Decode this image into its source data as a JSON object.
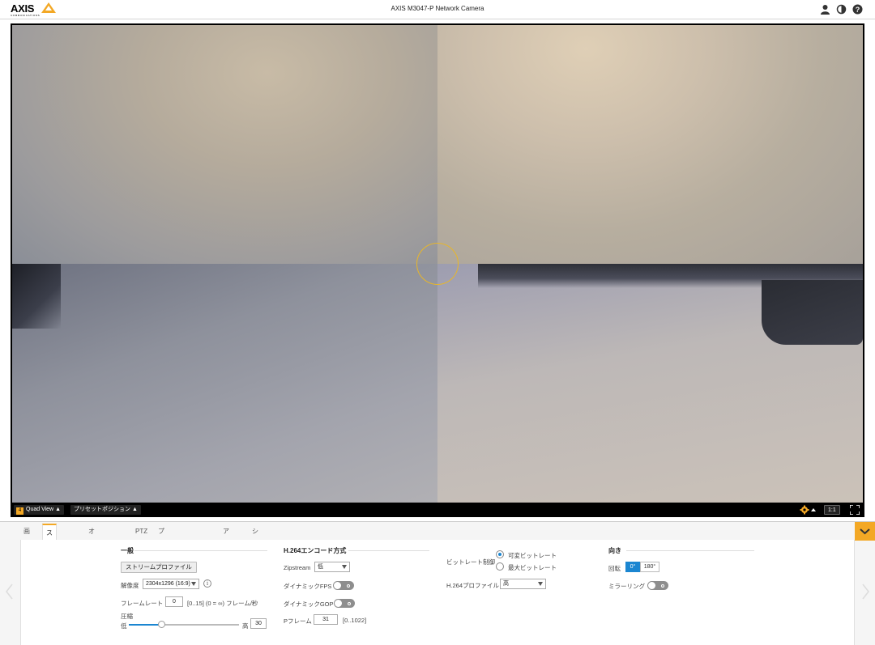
{
  "header": {
    "logo_word": "AXIS",
    "logo_sub": "COMMUNICATIONS",
    "title": "AXIS M3047-P Network Camera",
    "icons": [
      "user-icon",
      "contrast-icon",
      "help-icon"
    ]
  },
  "video_toolbar": {
    "quad_badge": "4",
    "quad_label": "Quad View",
    "preset_label": "プリセットポジション",
    "ratio_label": "1:1"
  },
  "tabs": [
    {
      "label": "画像",
      "active": false
    },
    {
      "label": "ストリーム",
      "active": true
    },
    {
      "label": "オーバーレイ",
      "active": false
    },
    {
      "label": "PTZ",
      "active": false
    },
    {
      "label": "プライバシーマスク",
      "active": false
    },
    {
      "label": "アプリ",
      "active": false
    },
    {
      "label": "システム",
      "active": false
    }
  ],
  "general": {
    "title": "一般",
    "stream_profile_button": "ストリームプロファイル",
    "resolution_label": "解像度",
    "resolution_value": "2304x1296 (16:9)",
    "framerate_label": "フレームレート",
    "framerate_value": "0",
    "framerate_hint": "[0..15] (0 = ∞) フレーム/秒",
    "compression_label": "圧縮",
    "compression_low": "低",
    "compression_high": "高",
    "compression_value": "30",
    "compression_fraction": 0.3
  },
  "h264": {
    "title": "H.264エンコード方式",
    "zipstream_label": "Zipstream",
    "zipstream_value": "低",
    "dynamic_fps_label": "ダイナミックFPS",
    "dynamic_gop_label": "ダイナミックGOP",
    "pframe_label": "Pフレーム",
    "pframe_value": "31",
    "pframe_hint": "[0..1022]"
  },
  "bitrate": {
    "control_label": "ビットレート制御",
    "option_variable": "可変ビットレート",
    "option_maximum": "最大ビットレート",
    "profile_label": "H.264プロファイル",
    "profile_value": "高"
  },
  "orientation": {
    "title": "向き",
    "rotation_label": "回転",
    "rotation_0": "0°",
    "rotation_180": "180°",
    "mirroring_label": "ミラーリング"
  },
  "colors": {
    "accent": "#f3a825",
    "selected_blue": "#1b86d1"
  }
}
